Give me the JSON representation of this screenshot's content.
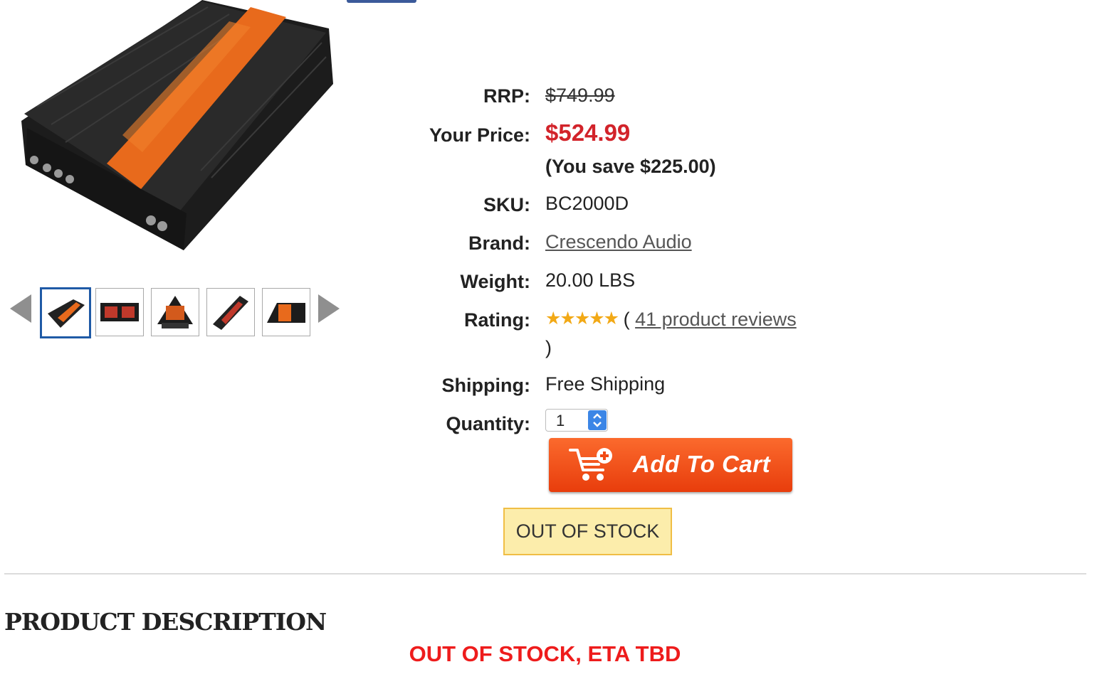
{
  "colors": {
    "price": "#d2232a",
    "cart_button": "#f14a14",
    "active_thumb_border": "#1f5aa6",
    "out_of_stock_bg": "#fcedab",
    "eta_red": "#ee1c1c"
  },
  "gallery": {
    "main_image_label": "amplifier-main-image",
    "prev_icon": "triangle-left-icon",
    "next_icon": "triangle-right-icon",
    "thumbnail_count": 5,
    "active_thumbnail": 1
  },
  "details": {
    "rrp_label": "RRP:",
    "rrp_value": "$749.99",
    "price_label": "Your Price:",
    "price_value": "$524.99",
    "savings": "(You save $225.00)",
    "sku_label": "SKU:",
    "sku_value": "BC2000D",
    "brand_label": "Brand:",
    "brand_value": "Crescendo Audio",
    "weight_label": "Weight:",
    "weight_value": "20.00 LBS",
    "rating_label": "Rating:",
    "rating_stars": 5,
    "rating_open": "(",
    "reviews_link": "41 product reviews",
    "rating_close": ")",
    "shipping_label": "Shipping:",
    "shipping_value": "Free Shipping",
    "quantity_label": "Quantity:",
    "quantity_value": "1"
  },
  "cart": {
    "button_label": "Add To Cart",
    "icon": "cart-plus-icon"
  },
  "stock": {
    "badge": "OUT OF STOCK"
  },
  "description": {
    "title": "PRODUCT DESCRIPTION",
    "eta": "OUT OF STOCK, ETA TBD"
  }
}
